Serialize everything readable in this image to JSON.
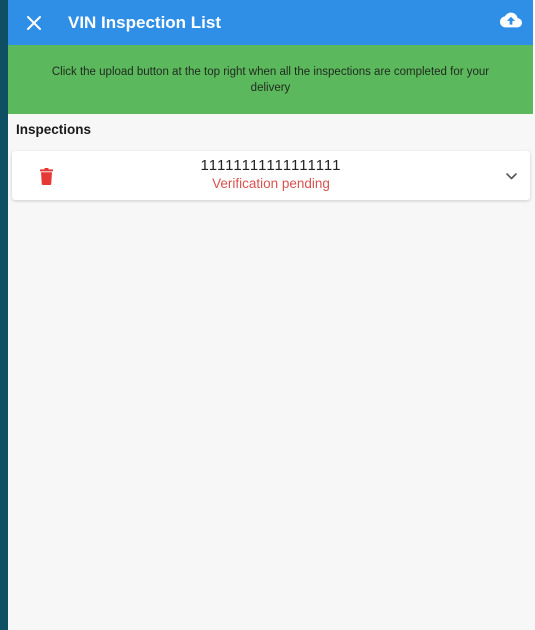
{
  "app_bar": {
    "title": "VIN Inspection List",
    "close_icon": "close-icon",
    "upload_icon": "cloud-upload-icon",
    "color": "#2f8fe6"
  },
  "banner": {
    "text": "Click the upload button at the top right when all the inspections are completed for your delivery",
    "color": "#5cb85c"
  },
  "inspections": {
    "title": "Inspections",
    "items": [
      {
        "vin": "11111111111111111",
        "status": "Verification pending",
        "status_color": "#d9534f",
        "delete_icon": "trash-icon",
        "expand_icon": "chevron-down-icon"
      }
    ]
  }
}
